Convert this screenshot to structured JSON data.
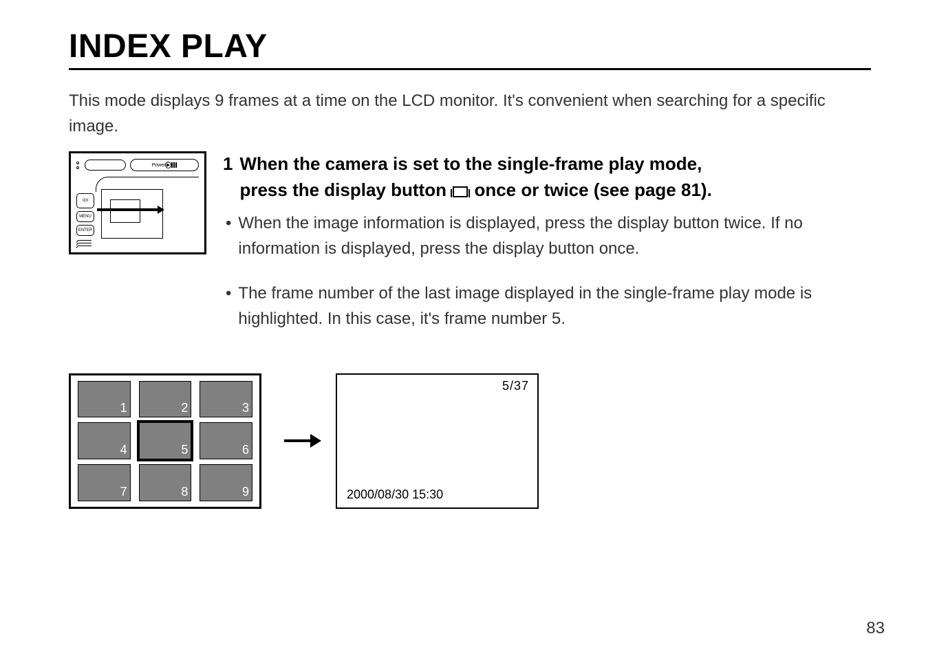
{
  "title": "INDEX PLAY",
  "intro": "This mode displays 9 frames at a time on the LCD monitor. It's convenient when searching for a specific image.",
  "camera": {
    "power_label": "Power",
    "btn_io": "IOI",
    "btn_menu": "MENU",
    "btn_enter": "ENTER"
  },
  "step": {
    "number": "1",
    "line1": "When the camera is set to the single-frame play mode,",
    "line2a": "press the display button",
    "line2b": "once or twice (see page 81)."
  },
  "bullets": [
    "When the image information is displayed, press the display button twice. If no information is displayed, press the display button once.",
    "The frame number of the last image displayed in the single-frame play mode is highlighted. In this case, it's frame number 5."
  ],
  "thumbs": [
    "1",
    "2",
    "3",
    "4",
    "5",
    "6",
    "7",
    "8",
    "9"
  ],
  "selected_index": 4,
  "single": {
    "counter": "5/37",
    "timestamp": "2000/08/30 15:30"
  },
  "page_number": "83"
}
